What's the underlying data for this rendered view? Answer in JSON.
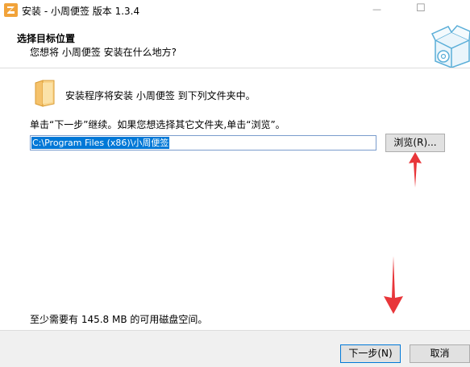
{
  "window": {
    "title": "安装 - 小周便签 版本 1.3.4",
    "minimize_glyph": "—",
    "maximize_glyph": "☐"
  },
  "header": {
    "title": "选择目标位置",
    "subtitle": "您想将 小周便签 安装在什么地方?"
  },
  "body": {
    "install_dir_text": "安装程序将安装 小周便签 到下列文件夹中。",
    "instruction": "单击“下一步”继续。如果您想选择其它文件夹,单击“浏览”。",
    "path_value": "C:\\Program Files (x86)\\小周便签",
    "browse_label": "浏览(R)...",
    "space_text": "至少需要有 145.8 MB 的可用磁盘空间。"
  },
  "footer": {
    "next_label": "下一步(N)",
    "cancel_label": "取消"
  },
  "colors": {
    "accent": "#0078d7",
    "annotation_arrow": "#e8363a",
    "folder": "#f5c26b",
    "app_icon": "#f1a33a"
  },
  "icons": [
    "app-logo-icon",
    "install-box-icon",
    "folder-icon"
  ]
}
